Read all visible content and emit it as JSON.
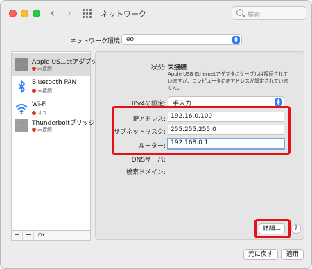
{
  "window": {
    "title": "ネットワーク",
    "search_placeholder": "検索"
  },
  "location": {
    "label": "ネットワーク環境:",
    "value": "eo"
  },
  "services": [
    {
      "name": "Apple US...etアダプタ",
      "status": "未接続",
      "status_color": "#e0342e",
      "icon": "ethernet-icon",
      "selected": true
    },
    {
      "name": "Bluetooth PAN",
      "status": "未接続",
      "status_color": "#e0342e",
      "icon": "bluetooth-icon",
      "selected": false
    },
    {
      "name": "Wi-Fi",
      "status": "オフ",
      "status_color": "#e0342e",
      "icon": "wifi-icon",
      "selected": false
    },
    {
      "name": "Thunderboltブリッジ",
      "status": "未接続",
      "status_color": "#e0342e",
      "icon": "ethernet-icon",
      "selected": false
    }
  ],
  "list_controls": {
    "add": "+",
    "remove": "−",
    "action": "⊙▾"
  },
  "detail": {
    "status_label": "状況:",
    "status_value": "未接続",
    "status_desc": "Apple USB Ethernetアダプタにケーブルは接続されていますが、コンピュータにIPアドレスが設定されていません。",
    "ipv4_label": "IPv4の設定:",
    "ipv4_value": "手入力",
    "ip_label": "IPアドレス:",
    "ip_value": "192.16.0.100",
    "subnet_label": "サブネットマスク:",
    "subnet_value": "255.255.255.0",
    "router_label": "ルーター:",
    "router_value": "192.168.0.1",
    "dns_label": "DNSサーバ:",
    "search_domain_label": "検索ドメイン:",
    "advanced_button": "詳細...",
    "help": "?"
  },
  "footer": {
    "revert_button": "元に戻す",
    "apply_button": "適用"
  },
  "colors": {
    "highlight": "#e5101a",
    "accent": "#2f7cf6",
    "status_red": "#e0342e"
  }
}
